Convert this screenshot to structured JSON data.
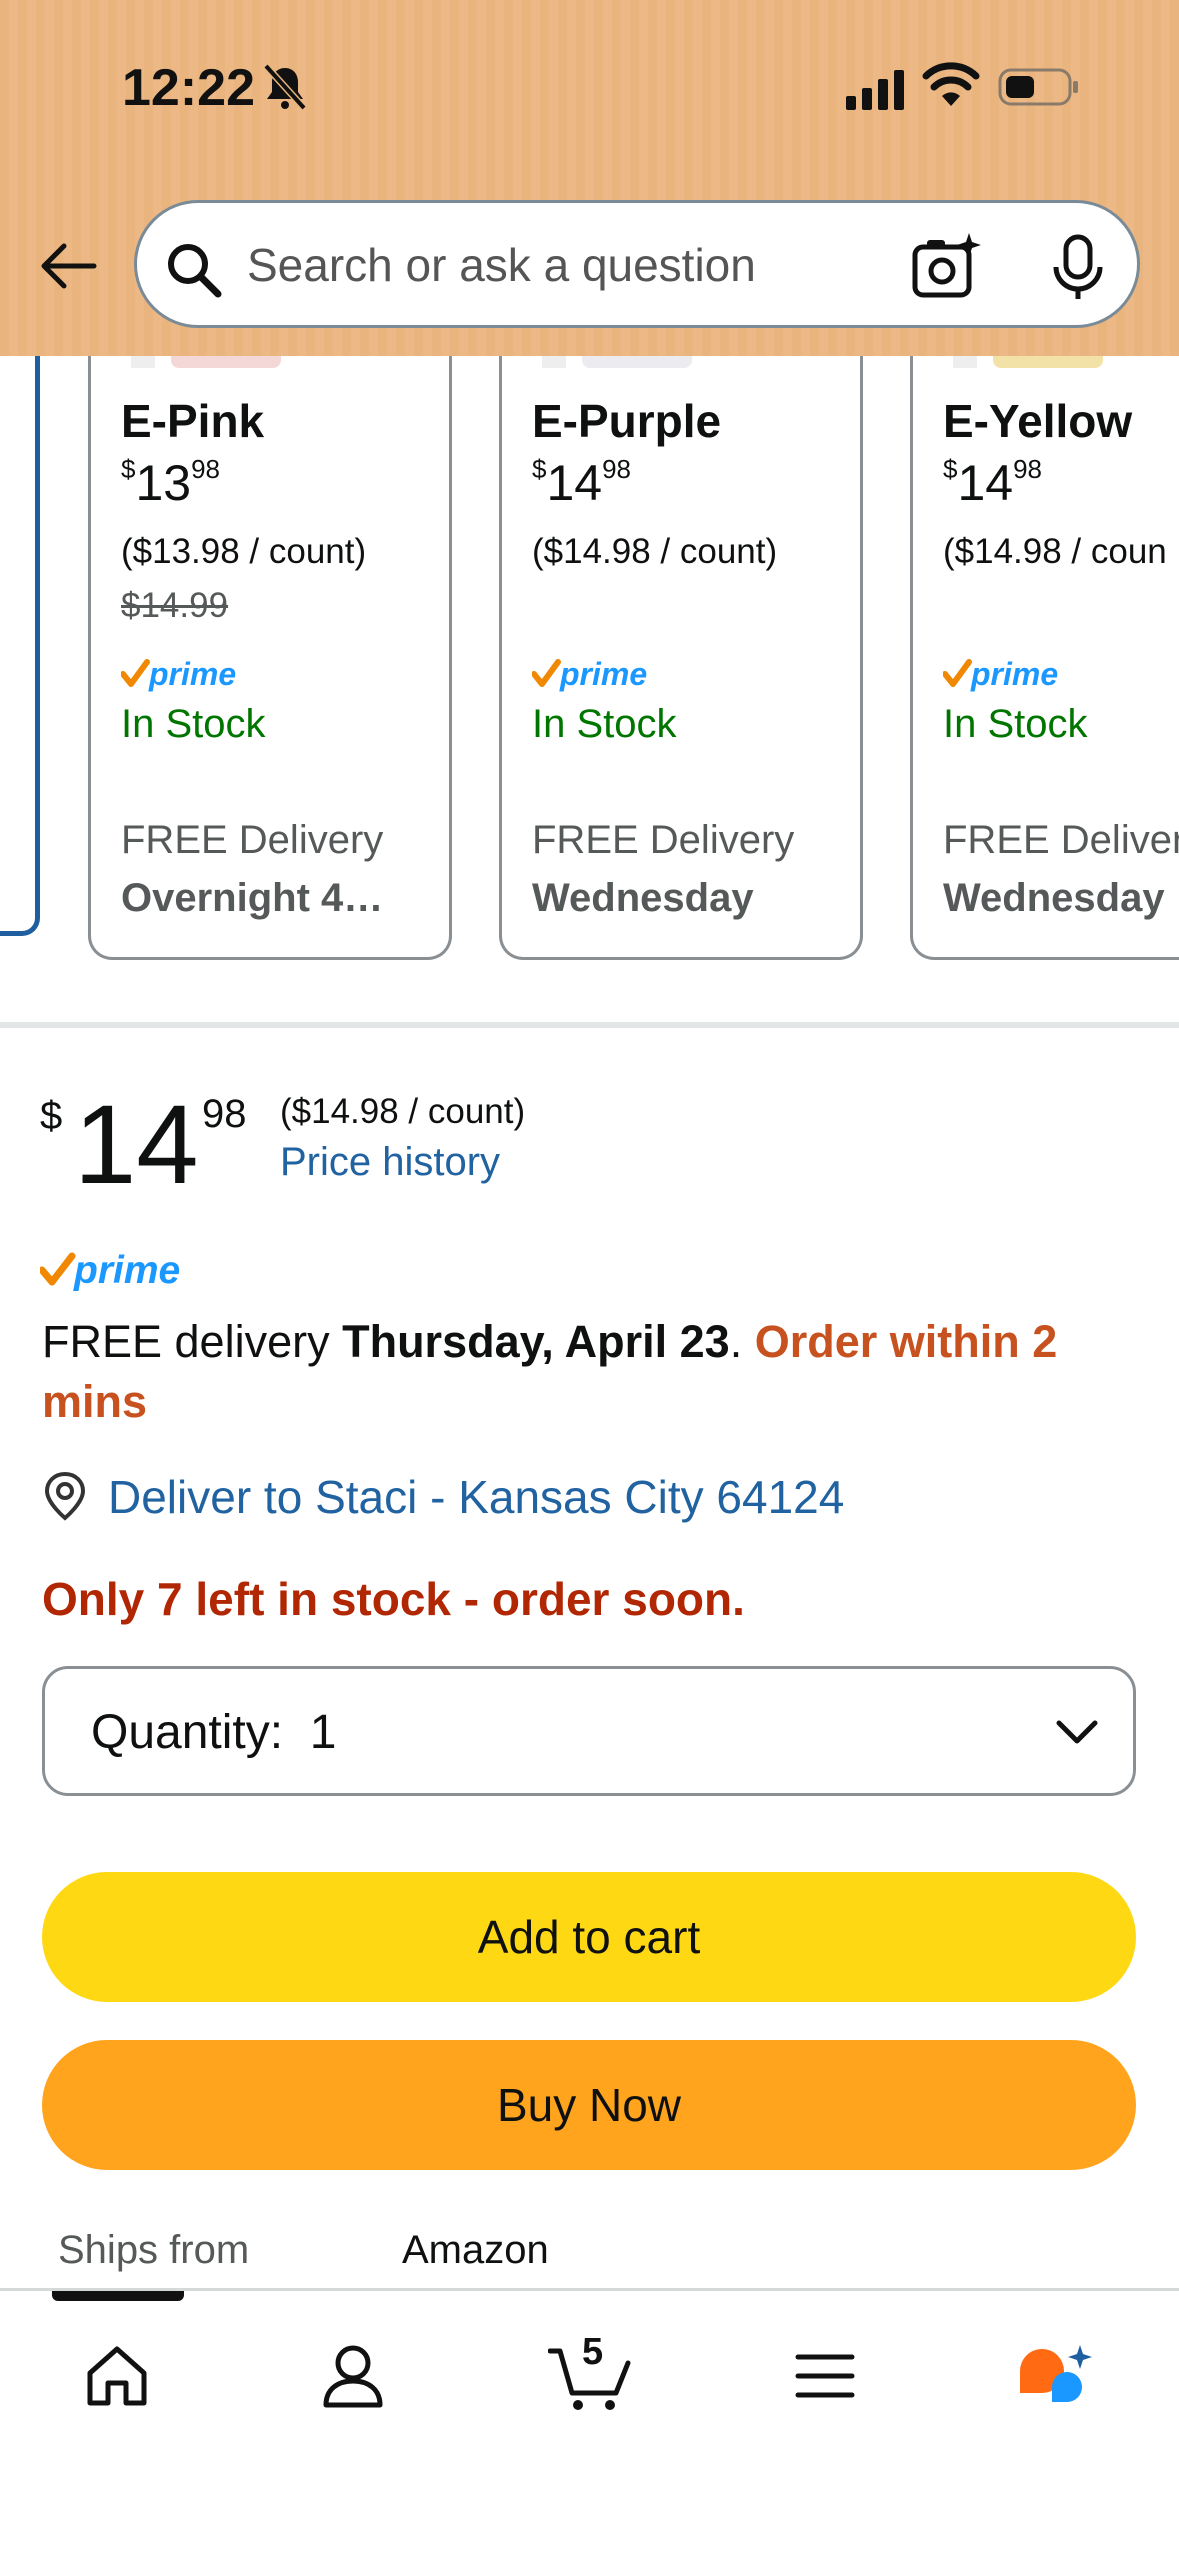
{
  "status_bar": {
    "time": "12:22"
  },
  "search": {
    "placeholder": "Search or ask a question"
  },
  "variants": [
    {
      "name": "E-Pink",
      "price_symbol": "$",
      "price_whole": "13",
      "price_fraction": "98",
      "unit_price": "($13.98 / count)",
      "list_price": "$14.99",
      "availability": "In Stock",
      "delivery_label": "FREE Delivery",
      "delivery_day": "Overnight 4…"
    },
    {
      "name": "E-Purple",
      "price_symbol": "$",
      "price_whole": "14",
      "price_fraction": "98",
      "unit_price": "($14.98 / count)",
      "availability": "In Stock",
      "delivery_label": "FREE Delivery",
      "delivery_day": "Wednesday"
    },
    {
      "name": "E-Yellow",
      "price_symbol": "$",
      "price_whole": "14",
      "price_fraction": "98",
      "unit_price": "($14.98 / coun",
      "availability": "In Stock",
      "delivery_label": "FREE Deliver",
      "delivery_day": "Wednesday"
    }
  ],
  "buybox": {
    "price_symbol": "$",
    "price_whole": "14",
    "price_fraction": "98",
    "unit_price": "($14.98 / count)",
    "price_history": "Price history",
    "delivery_prefix": "FREE delivery ",
    "delivery_date": "Thursday, April 23",
    "delivery_sep": ". ",
    "order_within": "Order within 2 mins",
    "deliver_to": "Deliver to Staci - Kansas City 64124",
    "stock_warning": "Only 7 left in stock - order soon.",
    "quantity_label": "Quantity:",
    "quantity_value": "1",
    "add_to_cart": "Add to cart",
    "buy_now": "Buy Now",
    "ships_from_label": "Ships from",
    "ships_from_value": "Amazon"
  },
  "bottom_nav": {
    "cart_count": "5"
  },
  "colors": {
    "header_bg": "#e9b47d",
    "link_blue": "#2162a1",
    "in_stock_green": "#007600",
    "urgent_orange": "#c7511f",
    "stock_warning_red": "#b12704",
    "add_to_cart_yellow": "#ffd814",
    "buy_now_orange": "#ffa41c",
    "prime_blue": "#1a98ff",
    "prime_check_orange": "#f08804"
  }
}
